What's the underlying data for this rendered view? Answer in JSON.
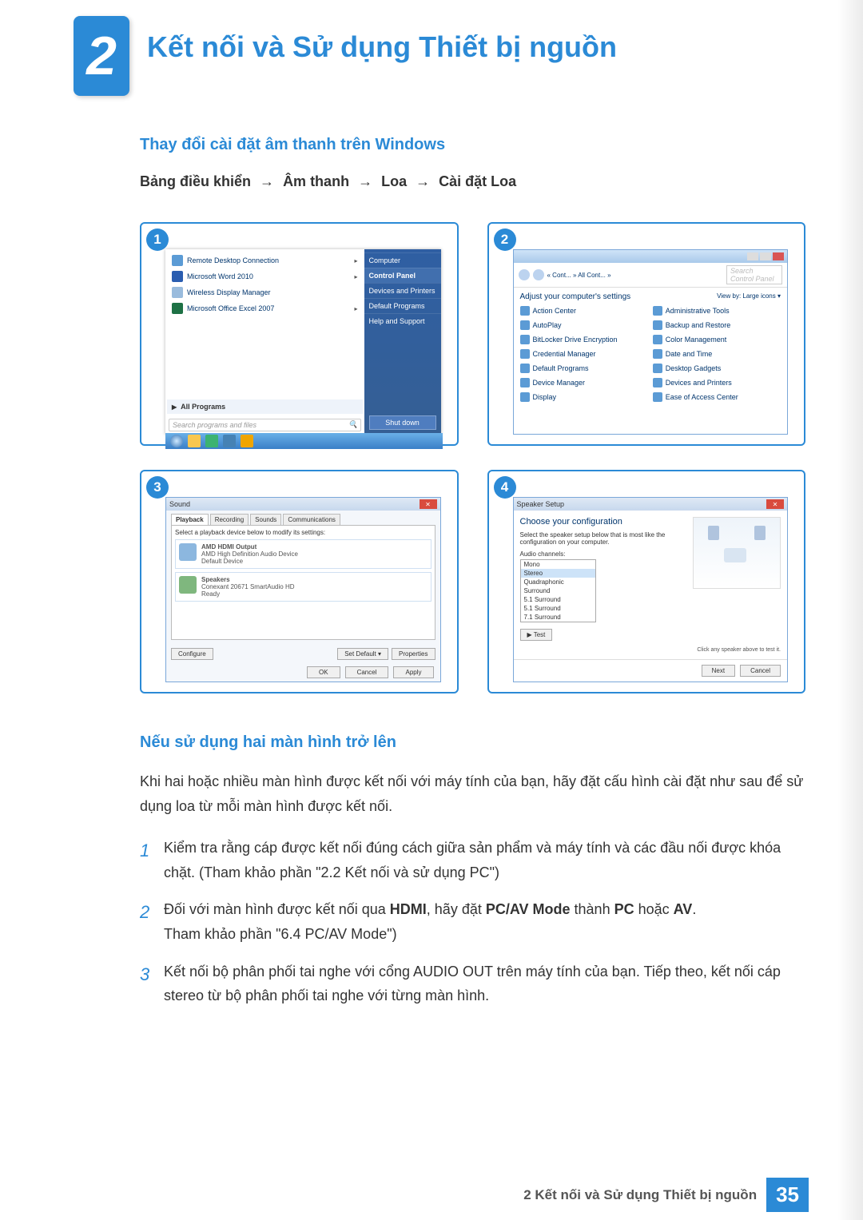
{
  "header": {
    "chapter_number": "2",
    "title": "Kết nối và Sử dụng Thiết bị nguồn"
  },
  "section1": {
    "heading": "Thay đổi cài đặt âm thanh trên Windows",
    "path": [
      "Bảng điều khiển",
      "Âm thanh",
      "Loa",
      "Cài đặt Loa"
    ]
  },
  "screens": {
    "step1": "1",
    "step2": "2",
    "step3": "3",
    "step4": "4",
    "startmenu": {
      "items": [
        {
          "label": "Remote Desktop Connection",
          "caret": true
        },
        {
          "label": "Microsoft Word 2010",
          "caret": true
        },
        {
          "label": "Wireless Display Manager"
        },
        {
          "label": "Microsoft Office Excel 2007",
          "caret": true
        }
      ],
      "all": "All Programs",
      "search": "Search programs and files",
      "right": [
        "Computer",
        "Control Panel",
        "Devices and Printers",
        "Default Programs",
        "Help and Support"
      ],
      "shutdown": "Shut down"
    },
    "controlpanel": {
      "crumb": "« Cont... » All Cont... »",
      "search": "Search Control Panel",
      "heading": "Adjust your computer's settings",
      "view": "View by:  Large icons ▾",
      "links_left": [
        "Action Center",
        "AutoPlay",
        "BitLocker Drive Encryption",
        "Credential Manager",
        "Default Programs",
        "Device Manager",
        "Display"
      ],
      "links_right": [
        "Administrative Tools",
        "Backup and Restore",
        "Color Management",
        "Date and Time",
        "Desktop Gadgets",
        "Devices and Printers",
        "Ease of Access Center"
      ]
    },
    "sound": {
      "title": "Sound",
      "tabs": [
        "Playback",
        "Recording",
        "Sounds",
        "Communications"
      ],
      "hint": "Select a playback device below to modify its settings:",
      "dev1_name": "AMD HDMI Output",
      "dev1_sub1": "AMD High Definition Audio Device",
      "dev1_sub2": "Default Device",
      "dev2_name": "Speakers",
      "dev2_sub1": "Conexant 20671 SmartAudio HD",
      "dev2_sub2": "Ready",
      "configure": "Configure",
      "setdefault": "Set Default ▾",
      "properties": "Properties",
      "ok": "OK",
      "cancel": "Cancel",
      "apply": "Apply"
    },
    "speaker": {
      "title": "Speaker Setup",
      "heading": "Choose your configuration",
      "hint": "Select the speaker setup below that is most like the configuration on your computer.",
      "label": "Audio channels:",
      "options": [
        "Mono",
        "Stereo",
        "Quadraphonic",
        "Surround",
        "5.1 Surround",
        "5.1 Surround",
        "7.1 Surround"
      ],
      "test": "▶ Test",
      "note": "Click any speaker above to test it.",
      "next": "Next",
      "cancel": "Cancel"
    }
  },
  "section2": {
    "heading": "Nếu sử dụng hai màn hình trở lên",
    "para": "Khi hai hoặc nhiều màn hình được kết nối với máy tính của bạn, hãy đặt cấu hình cài đặt như sau để sử dụng loa từ mỗi màn hình được kết nối.",
    "steps": [
      {
        "n": "1",
        "text": "Kiểm tra rằng cáp được kết nối đúng cách giữa sản phẩm và máy tính và các đầu nối được khóa chặt. (Tham khảo phần \"2.2 Kết nối và sử dụng PC\")"
      },
      {
        "n": "2",
        "pre": "Đối với màn hình được kết nối qua ",
        "b1": "HDMI",
        "mid": ", hãy đặt ",
        "b2": "PC/AV Mode",
        "mid2": " thành ",
        "b3": "PC",
        "mid3": " hoặc ",
        "b4": "AV",
        "post": ".",
        "line2": "Tham khảo phần \"6.4 PC/AV Mode\")"
      },
      {
        "n": "3",
        "text": "Kết nối bộ phân phối tai nghe với cổng AUDIO OUT trên máy tính của bạn. Tiếp theo, kết nối cáp stereo từ bộ phân phối tai nghe với từng màn hình."
      }
    ]
  },
  "footer": {
    "text": "2 Kết nối và Sử dụng Thiết bị nguồn",
    "page": "35"
  }
}
